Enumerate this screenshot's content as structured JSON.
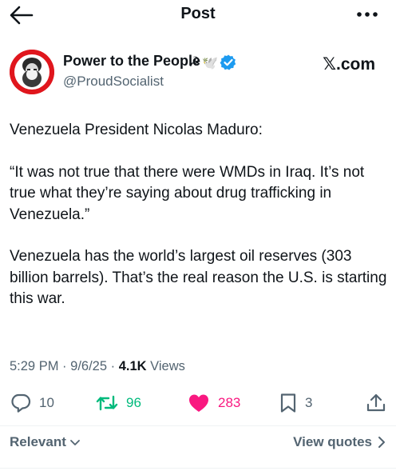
{
  "header": {
    "title": "Post"
  },
  "author": {
    "display_name": "Power to the People",
    "handle": "@ProudSocialist",
    "emoji_hammer_sickle": "☭",
    "emoji_dove": "🕊️",
    "site_tag": "𝕏.com"
  },
  "tweet": {
    "paragraphs": [
      "Venezuela President Nicolas Maduro:",
      "“It was not true that there were WMDs in Iraq. It’s not true what they’re saying about drug trafficking in Venezuela.”",
      "Venezuela has the world’s largest oil reserves (303 billion barrels). That’s the real reason the U.S. is starting this war."
    ]
  },
  "meta": {
    "time": "5:29 PM",
    "sep1": "·",
    "date": "9/6/25",
    "sep2": "·",
    "views_count": "4.1K",
    "views_label": "Views"
  },
  "actions": {
    "replies": "10",
    "reposts": "96",
    "likes": "283",
    "bookmarks": "3"
  },
  "footer": {
    "sort_label": "Relevant",
    "view_quotes_label": "View quotes"
  },
  "colors": {
    "text": "#0f1419",
    "muted": "#536471",
    "repost_green": "#00ba7c",
    "like_pink": "#f91880",
    "verified_blue": "#1d9bf0",
    "avatar_red": "#e0161d"
  },
  "icons": {
    "back": "arrow-left-icon",
    "more": "more-horizontal-icon",
    "verified": "verified-badge-icon",
    "reply": "reply-bubble-icon",
    "repost": "repost-arrows-icon",
    "like": "heart-filled-icon",
    "bookmark": "bookmark-icon",
    "share": "share-upload-icon",
    "chevron_down": "chevron-down-icon",
    "chevron_right": "chevron-right-icon"
  }
}
